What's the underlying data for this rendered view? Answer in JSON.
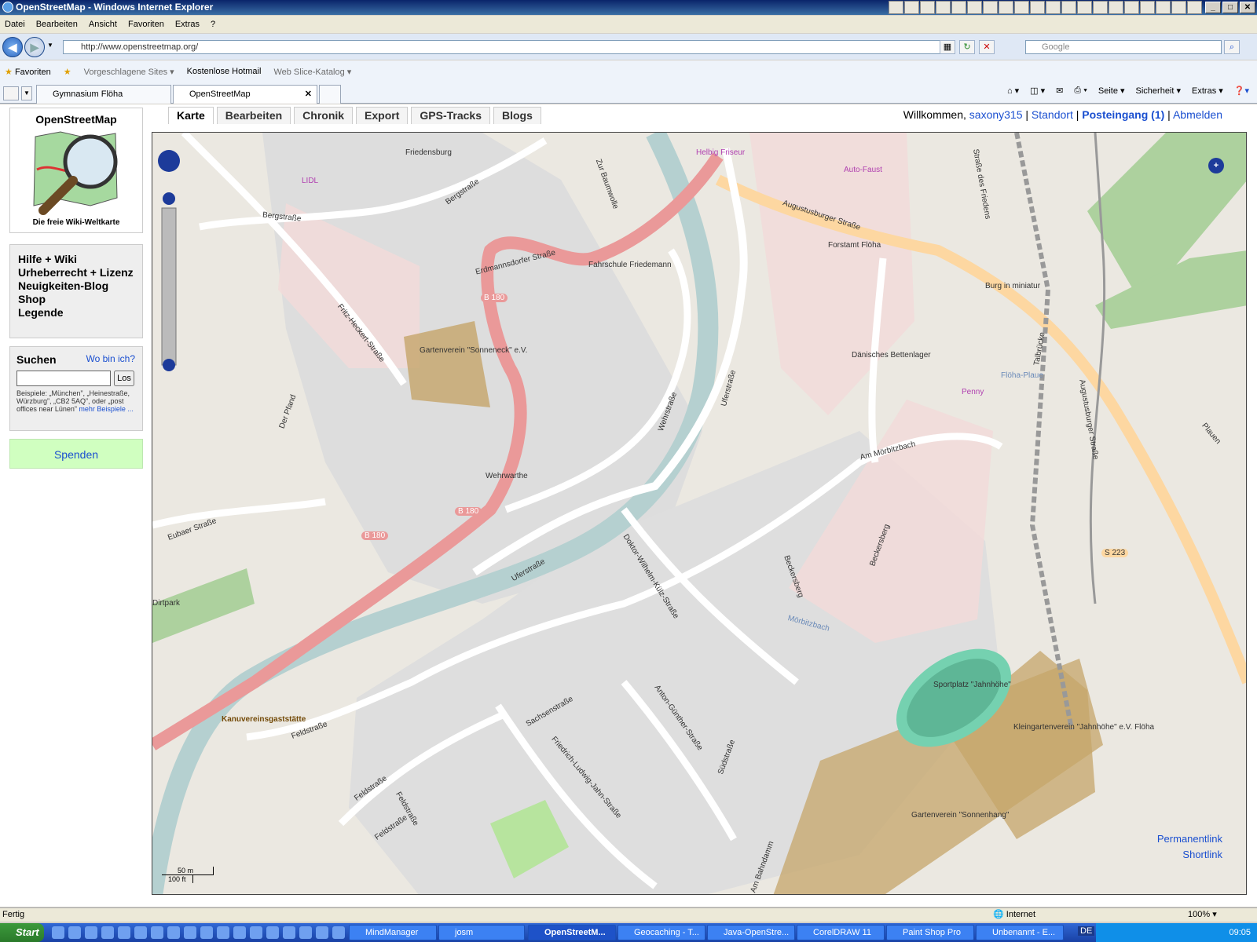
{
  "window": {
    "title": "OpenStreetMap - Windows Internet Explorer"
  },
  "menu": [
    "Datei",
    "Bearbeiten",
    "Ansicht",
    "Favoriten",
    "Extras",
    "?"
  ],
  "address": {
    "url": "http://www.openstreetmap.org/",
    "search_placeholder": "Google"
  },
  "favorites": {
    "label": "Favoriten",
    "suggested": "Vorgeschlagene Sites",
    "hotmail": "Kostenlose Hotmail",
    "webslice": "Web Slice-Katalog"
  },
  "tabs": [
    {
      "label": "Gymnasium Flöha"
    },
    {
      "label": "OpenStreetMap"
    }
  ],
  "commandbar": [
    "Seite",
    "Sicherheit",
    "Extras"
  ],
  "osm": {
    "logo_title": "OpenStreetMap",
    "logo_sub": "Die freie Wiki-Weltkarte",
    "help_links": [
      "Hilfe + Wiki",
      "Urheberrecht + Lizenz",
      "Neuigkeiten-Blog",
      "Shop",
      "Legende"
    ],
    "search": {
      "title": "Suchen",
      "where": "Wo bin ich?",
      "button": "Los",
      "hint": "Beispiele: „München”, „Heinestraße, Würzburg”, „CB2 5AQ”, oder „post offices near Lünen”",
      "more": "mehr Beispiele ..."
    },
    "donate": "Spenden",
    "tabs": [
      "Karte",
      "Bearbeiten",
      "Chronik",
      "Export",
      "GPS-Tracks",
      "Blogs"
    ],
    "user": {
      "welcome": "Willkommen,",
      "name": "saxony315",
      "standort": "Standort",
      "inbox": "Posteingang (1)",
      "logout": "Abmelden"
    },
    "permalink": "Permanentlink",
    "shortlink": "Shortlink",
    "scale": {
      "m": "50 m",
      "ft": "100 ft"
    }
  },
  "map_labels": {
    "friedensburg": "Friedensburg",
    "bergstrasse": "Bergstraße",
    "bergstrasse2": "Bergstraße",
    "lidl": "LIDL",
    "erdmannsdorfer": "Erdmannsdorfer Straße",
    "fahrschule": "Fahrschule Friedemann",
    "zur_baumwolle": "Zur Baumwolle",
    "augustusburger": "Augustusburger Straße",
    "augustusburger2": "Augustusburger Straße",
    "forstamt": "Forstamt Flöha",
    "autofaust": "Auto-Faust",
    "helbig": "Helbig Friseur",
    "strasse_des_friedens": "Straße des Friedens",
    "burg": "Burg in miniatur",
    "fritz": "Fritz-Heckert-Straße",
    "gartenverein1": "Gartenverein \"Sonneneck\" e.V.",
    "der_pfand": "Der Pfand",
    "b180a": "B 180",
    "b180b": "B 180",
    "b180c": "B 180",
    "wehrwarthe": "Wehrwarthe",
    "wehrstrasse": "Wehrstraße",
    "uferstrasse": "Uferstraße",
    "uferstrasse2": "Uferstraße",
    "daenisches": "Dänisches Bettenlager",
    "penny": "Penny",
    "floeha_plaue": "Flöha-Plaue",
    "talbruecke": "Talbrücke",
    "am_moerbitzbach": "Am Mörbitzbach",
    "eubaer": "Eubaer Straße",
    "dirtpark": "Dirtpark",
    "kuelz": "Doktor-Wilhelm-Külz-Straße",
    "beckersberg": "Beckersberg",
    "beckersberg2": "Beckersberg",
    "moerbitzbach": "Mörbitzbach",
    "s223": "S 223",
    "sportplatz": "Sportplatz \"Jahnhöhe\"",
    "kleingarten": "Kleingartenverein \"Jahnhöhe\" e.V. Flöha",
    "kanu": "Kanuvereinsgaststätte",
    "feldstrasse": "Feldstraße",
    "feldstrasse2": "Feldstraße",
    "feldstrasse3": "Feldstraße",
    "feldstrasse4": "Feldstraße",
    "sachsenstrasse": "Sachsenstraße",
    "anton": "Anton-Günther-Straße",
    "suedstrasse": "Südstraße",
    "jahnstrasse": "Friedrich-Ludwig-Jahn-Straße",
    "gartenverein2": "Gartenverein \"Sonnenhang\"",
    "am_bahndamm": "Am Bahndamm",
    "plauen": "Plauen"
  },
  "status": {
    "text": "Fertig",
    "zone": "Internet",
    "zoom": "100%"
  },
  "taskbar": {
    "start": "Start",
    "tasks": [
      "MindManager",
      "josm",
      "OpenStreetM...",
      "Geocaching - T...",
      "Java-OpenStre...",
      "CorelDRAW 11",
      "Paint Shop Pro",
      "Unbenannt - E..."
    ],
    "time": "09:05",
    "lang": "DE"
  },
  "colors": {
    "accent": "#1a4fd0",
    "primary_road": "#ea9999",
    "secondary_road": "#fdd7a1",
    "river": "#b5d0d0",
    "landuse": "#f2dad9"
  }
}
